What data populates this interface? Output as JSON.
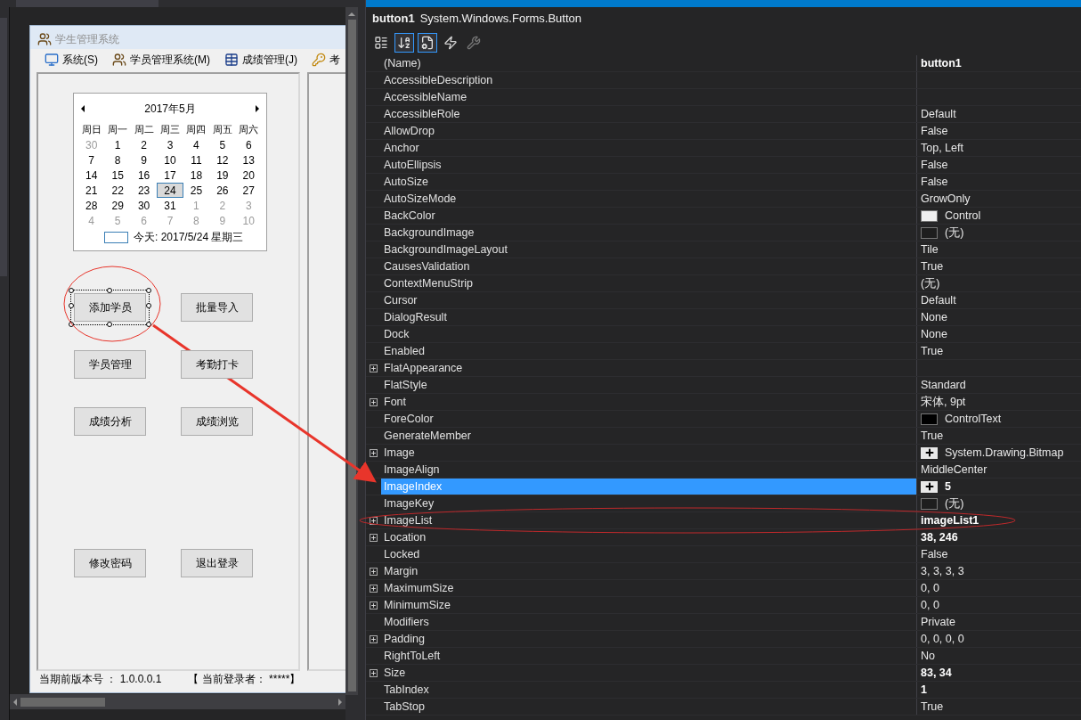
{
  "form": {
    "title": "学生管理系统",
    "menu": [
      {
        "kind": "monitor",
        "label": "系统(S)"
      },
      {
        "kind": "people",
        "label": "学员管理系统(M)"
      },
      {
        "kind": "table",
        "label": "成绩管理(J)"
      },
      {
        "kind": "key",
        "label": "考"
      }
    ],
    "calendar": {
      "month": "2017年5月",
      "weekdays": [
        "周日",
        "周一",
        "周二",
        "周三",
        "周四",
        "周五",
        "周六"
      ],
      "weeks": [
        [
          {
            "day": "30",
            "other_month": true,
            "selected": false
          },
          {
            "day": "1",
            "other_month": false,
            "selected": false
          },
          {
            "day": "2",
            "other_month": false,
            "selected": false
          },
          {
            "day": "3",
            "other_month": false,
            "selected": false
          },
          {
            "day": "4",
            "other_month": false,
            "selected": false
          },
          {
            "day": "5",
            "other_month": false,
            "selected": false
          },
          {
            "day": "6",
            "other_month": false,
            "selected": false
          }
        ],
        [
          {
            "day": "7",
            "other_month": false,
            "selected": false
          },
          {
            "day": "8",
            "other_month": false,
            "selected": false
          },
          {
            "day": "9",
            "other_month": false,
            "selected": false
          },
          {
            "day": "10",
            "other_month": false,
            "selected": false
          },
          {
            "day": "11",
            "other_month": false,
            "selected": false
          },
          {
            "day": "12",
            "other_month": false,
            "selected": false
          },
          {
            "day": "13",
            "other_month": false,
            "selected": false
          }
        ],
        [
          {
            "day": "14",
            "other_month": false,
            "selected": false
          },
          {
            "day": "15",
            "other_month": false,
            "selected": false
          },
          {
            "day": "16",
            "other_month": false,
            "selected": false
          },
          {
            "day": "17",
            "other_month": false,
            "selected": false
          },
          {
            "day": "18",
            "other_month": false,
            "selected": false
          },
          {
            "day": "19",
            "other_month": false,
            "selected": false
          },
          {
            "day": "20",
            "other_month": false,
            "selected": false
          }
        ],
        [
          {
            "day": "21",
            "other_month": false,
            "selected": false
          },
          {
            "day": "22",
            "other_month": false,
            "selected": false
          },
          {
            "day": "23",
            "other_month": false,
            "selected": false
          },
          {
            "day": "24",
            "other_month": false,
            "selected": true
          },
          {
            "day": "25",
            "other_month": false,
            "selected": false
          },
          {
            "day": "26",
            "other_month": false,
            "selected": false
          },
          {
            "day": "27",
            "other_month": false,
            "selected": false
          }
        ],
        [
          {
            "day": "28",
            "other_month": false,
            "selected": false
          },
          {
            "day": "29",
            "other_month": false,
            "selected": false
          },
          {
            "day": "30",
            "other_month": false,
            "selected": false
          },
          {
            "day": "31",
            "other_month": false,
            "selected": false
          },
          {
            "day": "1",
            "other_month": true,
            "selected": false
          },
          {
            "day": "2",
            "other_month": true,
            "selected": false
          },
          {
            "day": "3",
            "other_month": true,
            "selected": false
          }
        ],
        [
          {
            "day": "4",
            "other_month": true,
            "selected": false
          },
          {
            "day": "5",
            "other_month": true,
            "selected": false
          },
          {
            "day": "6",
            "other_month": true,
            "selected": false
          },
          {
            "day": "7",
            "other_month": true,
            "selected": false
          },
          {
            "day": "8",
            "other_month": true,
            "selected": false
          },
          {
            "day": "9",
            "other_month": true,
            "selected": false
          },
          {
            "day": "10",
            "other_month": true,
            "selected": false
          }
        ]
      ],
      "today": "今天: 2017/5/24 星期三"
    },
    "button_rows": [
      [
        {
          "label": "添加学员",
          "selected": true
        },
        {
          "label": "批量导入",
          "selected": false
        }
      ],
      [
        {
          "label": "学员管理",
          "selected": false
        },
        {
          "label": "考勤打卡",
          "selected": false
        }
      ],
      [
        {
          "label": "成绩分析",
          "selected": false
        },
        {
          "label": "成绩浏览",
          "selected": false
        }
      ],
      [
        {
          "label": "修改密码",
          "selected": false
        },
        {
          "label": "退出登录",
          "selected": false
        }
      ]
    ],
    "status_bar": [
      "当期前版本号 ： 1.0.0.0.1",
      "【  当前登录者： *****】"
    ]
  },
  "properties": {
    "object_name": "button1",
    "object_type": "System.Windows.Forms.Button",
    "toolbar": [
      {
        "kind": "categorized",
        "selected": false
      },
      {
        "kind": "alphabetical",
        "selected": true
      },
      {
        "kind": "properties",
        "selected": true
      },
      {
        "kind": "events",
        "selected": false
      },
      {
        "kind": "pages",
        "selected": false
      }
    ],
    "rows": [
      {
        "name": "(Name)",
        "value": "button1",
        "bold": true,
        "expandable": false,
        "selected": false
      },
      {
        "name": "AccessibleDescription",
        "expandable": false,
        "selected": false
      },
      {
        "name": "AccessibleName",
        "expandable": false,
        "selected": false
      },
      {
        "name": "AccessibleRole",
        "value": "Default",
        "bold": false,
        "expandable": false,
        "selected": false
      },
      {
        "name": "AllowDrop",
        "value": "False",
        "bold": false,
        "expandable": false,
        "selected": false
      },
      {
        "name": "Anchor",
        "value": "Top, Left",
        "bold": false,
        "expandable": false,
        "selected": false
      },
      {
        "name": "AutoEllipsis",
        "value": "False",
        "bold": false,
        "expandable": false,
        "selected": false
      },
      {
        "name": "AutoSize",
        "value": "False",
        "bold": false,
        "expandable": false,
        "selected": false
      },
      {
        "name": "AutoSizeMode",
        "value": "GrowOnly",
        "bold": false,
        "expandable": false,
        "selected": false
      },
      {
        "name": "BackColor",
        "value": "Control",
        "color": "#f0f0f0",
        "bold": false,
        "expandable": false,
        "selected": false
      },
      {
        "name": "BackgroundImage",
        "value": "(无)",
        "color": "#1e1e1e",
        "bold": false,
        "expandable": false,
        "selected": false
      },
      {
        "name": "BackgroundImageLayout",
        "value": "Tile",
        "bold": false,
        "expandable": false,
        "selected": false
      },
      {
        "name": "CausesValidation",
        "value": "True",
        "bold": false,
        "expandable": false,
        "selected": false
      },
      {
        "name": "ContextMenuStrip",
        "value": "(无)",
        "bold": false,
        "expandable": false,
        "selected": false
      },
      {
        "name": "Cursor",
        "value": "Default",
        "bold": false,
        "expandable": false,
        "selected": false
      },
      {
        "name": "DialogResult",
        "value": "None",
        "bold": false,
        "expandable": false,
        "selected": false
      },
      {
        "name": "Dock",
        "value": "None",
        "bold": false,
        "expandable": false,
        "selected": false
      },
      {
        "name": "Enabled",
        "value": "True",
        "bold": false,
        "expandable": false,
        "selected": false
      },
      {
        "name": "FlatAppearance",
        "expandable": true,
        "selected": false
      },
      {
        "name": "FlatStyle",
        "value": "Standard",
        "bold": false,
        "expandable": false,
        "selected": false
      },
      {
        "name": "Font",
        "value": "宋体, 9pt",
        "bold": false,
        "expandable": true,
        "selected": false
      },
      {
        "name": "ForeColor",
        "value": "ControlText",
        "color": "#000000",
        "bold": false,
        "expandable": false,
        "selected": false
      },
      {
        "name": "GenerateMember",
        "value": "True",
        "bold": false,
        "expandable": false,
        "selected": false
      },
      {
        "name": "Image",
        "value": "System.Drawing.Bitmap",
        "kind": "image",
        "bold": false,
        "expandable": true,
        "selected": false
      },
      {
        "name": "ImageAlign",
        "value": "MiddleCenter",
        "bold": false,
        "expandable": false,
        "selected": false
      },
      {
        "name": "ImageIndex",
        "value": "5",
        "kind": "image",
        "bold": true,
        "expandable": false,
        "selected": true
      },
      {
        "name": "ImageKey",
        "value": "(无)",
        "color": "#1e1e1e",
        "bold": false,
        "expandable": false,
        "selected": false
      },
      {
        "name": "ImageList",
        "value": "imageList1",
        "bold": true,
        "expandable": true,
        "selected": false
      },
      {
        "name": "Location",
        "value": "38, 246",
        "bold": true,
        "expandable": true,
        "selected": false
      },
      {
        "name": "Locked",
        "value": "False",
        "bold": false,
        "expandable": false,
        "selected": false
      },
      {
        "name": "Margin",
        "value": "3, 3, 3, 3",
        "bold": false,
        "expandable": true,
        "selected": false
      },
      {
        "name": "MaximumSize",
        "value": "0, 0",
        "bold": false,
        "expandable": true,
        "selected": false
      },
      {
        "name": "MinimumSize",
        "value": "0, 0",
        "bold": false,
        "expandable": true,
        "selected": false
      },
      {
        "name": "Modifiers",
        "value": "Private",
        "bold": false,
        "expandable": false,
        "selected": false
      },
      {
        "name": "Padding",
        "value": "0, 0, 0, 0",
        "bold": false,
        "expandable": true,
        "selected": false
      },
      {
        "name": "RightToLeft",
        "value": "No",
        "bold": false,
        "expandable": false,
        "selected": false
      },
      {
        "name": "Size",
        "value": "83, 34",
        "bold": true,
        "expandable": true,
        "selected": false
      },
      {
        "name": "TabIndex",
        "value": "1",
        "bold": true,
        "expandable": false,
        "selected": false
      },
      {
        "name": "TabStop",
        "value": "True",
        "bold": false,
        "expandable": false,
        "selected": false
      }
    ]
  }
}
